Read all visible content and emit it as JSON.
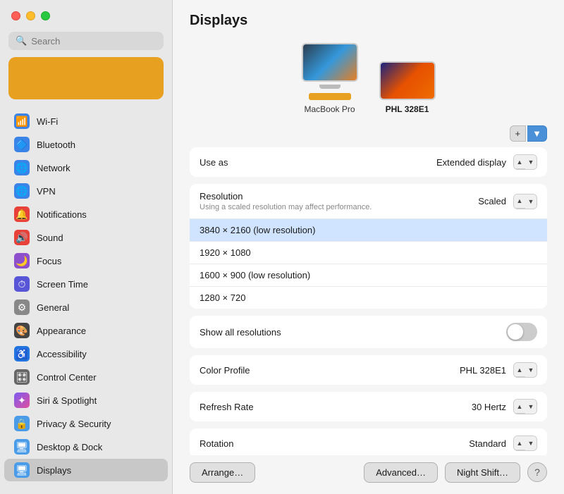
{
  "sidebar": {
    "search_placeholder": "Search",
    "items": [
      {
        "id": "wifi",
        "label": "Wi-Fi",
        "icon": "wifi",
        "icon_char": "📶"
      },
      {
        "id": "bluetooth",
        "label": "Bluetooth",
        "icon": "bluetooth",
        "icon_char": "🔷"
      },
      {
        "id": "network",
        "label": "Network",
        "icon": "network",
        "icon_char": "🌐"
      },
      {
        "id": "vpn",
        "label": "VPN",
        "icon": "vpn",
        "icon_char": "🌐"
      },
      {
        "id": "notifications",
        "label": "Notifications",
        "icon": "notifications",
        "icon_char": "🔔"
      },
      {
        "id": "sound",
        "label": "Sound",
        "icon": "sound",
        "icon_char": "🔊"
      },
      {
        "id": "focus",
        "label": "Focus",
        "icon": "focus",
        "icon_char": "🌙"
      },
      {
        "id": "screentime",
        "label": "Screen Time",
        "icon": "screentime",
        "icon_char": "⏱"
      },
      {
        "id": "general",
        "label": "General",
        "icon": "general",
        "icon_char": "⚙️"
      },
      {
        "id": "appearance",
        "label": "Appearance",
        "icon": "appearance",
        "icon_char": "🎨"
      },
      {
        "id": "accessibility",
        "label": "Accessibility",
        "icon": "accessibility",
        "icon_char": "♿"
      },
      {
        "id": "controlcenter",
        "label": "Control Center",
        "icon": "controlcenter",
        "icon_char": "🎛"
      },
      {
        "id": "siri",
        "label": "Siri & Spotlight",
        "icon": "siri",
        "icon_char": "✨"
      },
      {
        "id": "privacy",
        "label": "Privacy & Security",
        "icon": "privacy",
        "icon_char": "🔒"
      },
      {
        "id": "desktop",
        "label": "Desktop & Dock",
        "icon": "desktop",
        "icon_char": "🖥"
      },
      {
        "id": "displays",
        "label": "Displays",
        "icon": "displays",
        "icon_char": "🖥"
      }
    ]
  },
  "main": {
    "title": "Displays",
    "displays": [
      {
        "id": "macbook",
        "label": "MacBook Pro",
        "active": false
      },
      {
        "id": "external",
        "label": "PHL 328E1",
        "active": true
      }
    ],
    "toolbar": {
      "add_label": "+",
      "dropdown_label": "▼"
    },
    "use_as": {
      "label": "Use as",
      "value": "Extended display",
      "stepper_up": "▲",
      "stepper_down": "▼"
    },
    "resolution": {
      "label": "Resolution",
      "value": "Scaled",
      "sublabel": "Using a scaled resolution may affect performance.",
      "stepper_up": "▲",
      "stepper_down": "▼",
      "options": [
        {
          "id": "res1",
          "label": "3840 × 2160 (low resolution)",
          "selected": true
        },
        {
          "id": "res2",
          "label": "1920 × 1080",
          "selected": false
        },
        {
          "id": "res3",
          "label": "1600 × 900 (low resolution)",
          "selected": false
        },
        {
          "id": "res4",
          "label": "1280 × 720",
          "selected": false
        }
      ]
    },
    "show_all": {
      "label": "Show all resolutions",
      "enabled": false
    },
    "color_profile": {
      "label": "Color Profile",
      "value": "PHL 328E1",
      "stepper_up": "▲",
      "stepper_down": "▼"
    },
    "refresh_rate": {
      "label": "Refresh Rate",
      "value": "30 Hertz",
      "stepper_up": "▲",
      "stepper_down": "▼"
    },
    "rotation": {
      "label": "Rotation",
      "value": "Standard",
      "stepper_up": "▲",
      "stepper_down": "▼"
    },
    "buttons": {
      "arrange": "Arrange…",
      "advanced": "Advanced…",
      "night_shift": "Night Shift…",
      "help": "?"
    }
  }
}
